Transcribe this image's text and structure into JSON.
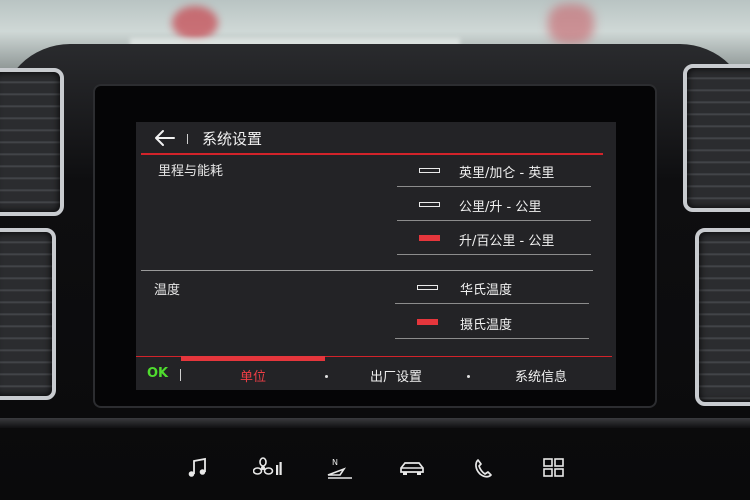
{
  "header": {
    "title": "系统设置"
  },
  "sections": [
    {
      "label": "里程与能耗",
      "options": [
        {
          "label": "英里/加仑 - 英里",
          "selected": false
        },
        {
          "label": "公里/升 - 公里",
          "selected": false
        },
        {
          "label": "升/百公里 - 公里",
          "selected": true
        }
      ]
    },
    {
      "label": "温度",
      "options": [
        {
          "label": "华氏温度",
          "selected": false
        },
        {
          "label": "摄氏温度",
          "selected": true
        }
      ]
    }
  ],
  "tabbar": {
    "ok_label": "OK",
    "tabs": [
      {
        "label": "单位",
        "active": true
      },
      {
        "label": "出厂设置",
        "active": false
      },
      {
        "label": "系统信息",
        "active": false
      }
    ]
  },
  "hard_keys": [
    "music-icon",
    "fan-icon",
    "navigation-icon",
    "car-icon",
    "phone-icon",
    "apps-grid-icon"
  ],
  "colors": {
    "accent": "#e5363c",
    "ok": "#4fdc2e",
    "screen_bg": "#232326"
  }
}
